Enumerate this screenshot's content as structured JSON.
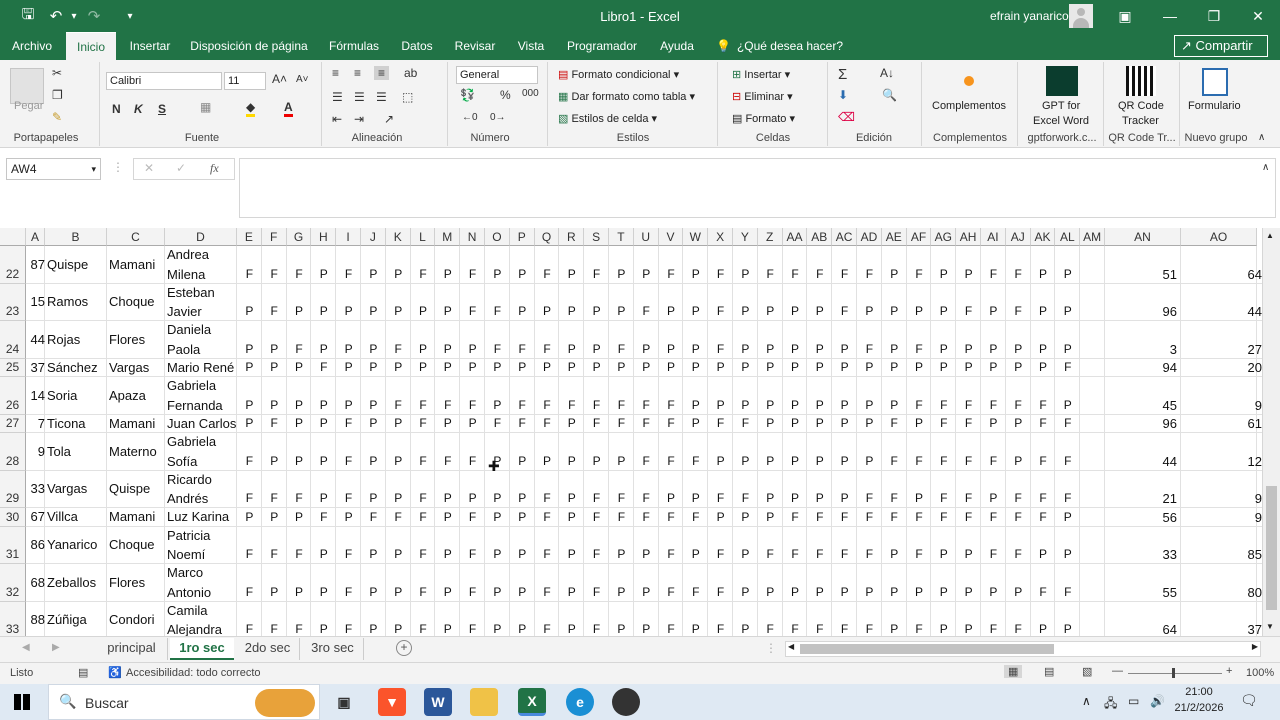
{
  "window": {
    "title": "Libro1 - Excel",
    "user": "efrain yanarico"
  },
  "tabs": [
    "Archivo",
    "Inicio",
    "Insertar",
    "Disposición de página",
    "Fórmulas",
    "Datos",
    "Revisar",
    "Vista",
    "Programador",
    "Ayuda"
  ],
  "tell_me": "¿Qué desea hacer?",
  "share": "Compartir",
  "ribbon": {
    "clipboard": {
      "label": "Portapapeles",
      "paste": "Pegar"
    },
    "font": {
      "label": "Fuente",
      "name": "Calibri",
      "size": "11",
      "bold": "N",
      "italic": "K",
      "underline": "S"
    },
    "alignment": {
      "label": "Alineación"
    },
    "number": {
      "label": "Número",
      "format": "General",
      "percent": "%",
      "thousands": "000"
    },
    "styles": {
      "label": "Estilos",
      "conditional": "Formato condicional",
      "table": "Dar formato como tabla",
      "cell": "Estilos de celda"
    },
    "cells": {
      "label": "Celdas",
      "insert": "Insertar",
      "delete": "Eliminar",
      "format": "Formato"
    },
    "editing": {
      "label": "Edición"
    },
    "addins": {
      "label": "Complementos",
      "button": "Complementos"
    },
    "gpt": {
      "line1": "GPT for",
      "line2": "Excel Word",
      "group": "gptforwork.c..."
    },
    "qr": {
      "line1": "QR Code",
      "line2": "Tracker",
      "group": "QR Code Tr..."
    },
    "form": {
      "button": "Formulario",
      "group": "Nuevo grupo"
    }
  },
  "namebox": "AW4",
  "fx": "fx",
  "columns": [
    "A",
    "B",
    "C",
    "D",
    "E",
    "F",
    "G",
    "H",
    "I",
    "J",
    "K",
    "L",
    "M",
    "N",
    "O",
    "P",
    "Q",
    "R",
    "S",
    "T",
    "U",
    "V",
    "W",
    "X",
    "Y",
    "Z",
    "AA",
    "AB",
    "AC",
    "AD",
    "AE",
    "AF",
    "AG",
    "AH",
    "AI",
    "AJ",
    "AK",
    "AL",
    "AM",
    "AN",
    "AO"
  ],
  "rows": [
    {
      "num": "22",
      "a": "87",
      "b": "Quispe",
      "c": "Mamani",
      "d1": "Andrea",
      "d2": "Milena",
      "marks": "FFFPFPPFPFPPFPFPPFPFPFFFFFPFPPFFPP",
      "an": "51",
      "ao": "64"
    },
    {
      "num": "23",
      "a": "15",
      "b": "Ramos",
      "c": "Choque",
      "d1": "Esteban",
      "d2": "Javier",
      "marks": "PFPPPPPPPFFPPPPPFPPFPPPPFPPPPFPFPP",
      "an": "96",
      "ao": "44"
    },
    {
      "num": "24",
      "a": "44",
      "b": "Rojas",
      "c": "Flores",
      "d1": "Daniela",
      "d2": "Paola",
      "marks": "PPFPPPFPPPFFFPPFPPPFPPPPPFPFPPPPPP",
      "an": "3",
      "ao": "27"
    },
    {
      "num": "25",
      "a": "37",
      "b": "Sánchez",
      "c": "Vargas",
      "d1": "Mario René",
      "d2": "",
      "marks": "PPPFPPPPPPPPPPPPPPPPPPPPPPPPPPPPPF",
      "an": "94",
      "ao": "20"
    },
    {
      "num": "26",
      "a": "14",
      "b": "Soria",
      "c": "Apaza",
      "d1": "Gabriela",
      "d2": "Fernanda",
      "marks": "PPPPPPFFFFPFFFFFFFPPPPPPPPPFFFFFFP",
      "an": "45",
      "ao": "9"
    },
    {
      "num": "27",
      "a": "7",
      "b": "Ticona",
      "c": "Mamani",
      "d1": "Juan Carlos",
      "d2": "",
      "marks": "PFPPFPPFPPFFFPFFFFPFFPPPPPFPFFPPFF",
      "an": "96",
      "ao": "61"
    },
    {
      "num": "28",
      "a": "9",
      "b": "Tola",
      "c": "Materno",
      "d1": "Gabriela",
      "d2": "Sofía",
      "marks": "FPPPFPPFFFPPPPPPFFFPPPPPPPFFFFFPFF",
      "an": "44",
      "ao": "12"
    },
    {
      "num": "29",
      "a": "33",
      "b": "Vargas",
      "c": "Quispe",
      "d1": "Ricardo",
      "d2": "Andrés",
      "marks": "FFFPFPPFPPPPFPFFFPPFFPPPPFFPFFPFFF",
      "an": "21",
      "ao": "9"
    },
    {
      "num": "30",
      "a": "67",
      "b": "Villca",
      "c": "Mamani",
      "d1": "Luz Karina",
      "d2": "",
      "marks": "PPPFPFFFPFPPFPFFFFFPPPFFFFFFFFFFFP",
      "an": "56",
      "ao": "9"
    },
    {
      "num": "31",
      "a": "86",
      "b": "Yanarico",
      "c": "Choque",
      "d1": "Patricia",
      "d2": "Noemí",
      "marks": "FFFPFPPFPFPPFPFPPFPFPFFFFFPFPPFFPP",
      "an": "33",
      "ao": "85"
    },
    {
      "num": "32",
      "a": "68",
      "b": "Zeballos",
      "c": "Flores",
      "d1": "Marco",
      "d2": "Antonio",
      "marks": "FPPPFPPFPFPPFPFPPFFFPPPPPPPPPPPPFF",
      "an": "55",
      "ao": "80"
    },
    {
      "num": "33",
      "a": "88",
      "b": "Zúñiga",
      "c": "Condori",
      "d1": "Camila",
      "d2": "Alejandra",
      "marks": "FFFPFPPFPFPPFPFPPFPFPFFFFFPFPPFFPP",
      "an": "64",
      "ao": "37"
    }
  ],
  "sheets": [
    "principal",
    "1ro sec",
    "2do sec",
    "3ro sec"
  ],
  "status": {
    "ready": "Listo",
    "accessibility": "Accesibilidad: todo correcto",
    "zoom": "100%"
  },
  "taskbar": {
    "search": "Buscar",
    "time": "21:00",
    "date": "21/2/2026"
  }
}
